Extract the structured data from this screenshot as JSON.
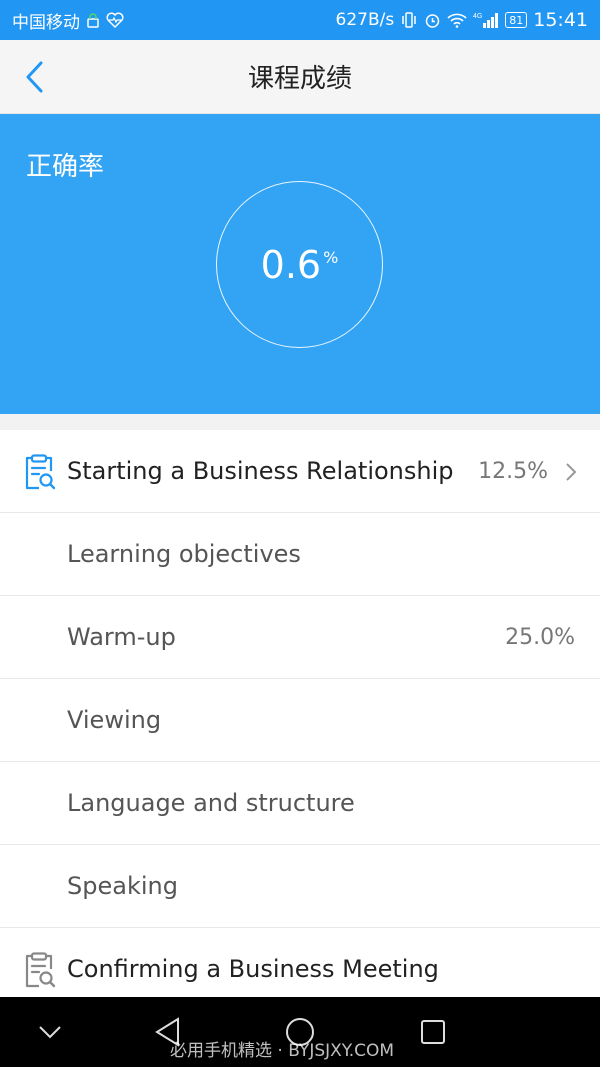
{
  "status_bar": {
    "carrier": "中国移动",
    "net_speed": "627B/s",
    "network": "4G",
    "battery": "81",
    "time": "15:41"
  },
  "header": {
    "title": "课程成绩",
    "back_icon": "chevron-left-icon"
  },
  "accuracy": {
    "label": "正确率",
    "value": "0.6",
    "unit": "%"
  },
  "list": {
    "rows": [
      {
        "label": "Starting a Business Relationship",
        "score": "12.5%",
        "type": "unit",
        "icon": "clipboard-search-icon",
        "active": true
      },
      {
        "label": "Learning objectives",
        "score": "",
        "type": "section"
      },
      {
        "label": "Warm-up",
        "score": "25.0%",
        "type": "section"
      },
      {
        "label": "Viewing",
        "score": "",
        "type": "section"
      },
      {
        "label": "Language and structure",
        "score": "",
        "type": "section"
      },
      {
        "label": "Speaking",
        "score": "",
        "type": "section"
      },
      {
        "label": "Confirming a Business Meeting",
        "score": "",
        "type": "unit",
        "icon": "clipboard-search-icon",
        "active": false
      }
    ]
  },
  "colors": {
    "primary": "#2196f3",
    "panel": "#33a3f4",
    "icon_active": "#2196f3",
    "icon_inactive": "#888888"
  },
  "watermark": "必用手机精选 · BYJSJXY.COM"
}
